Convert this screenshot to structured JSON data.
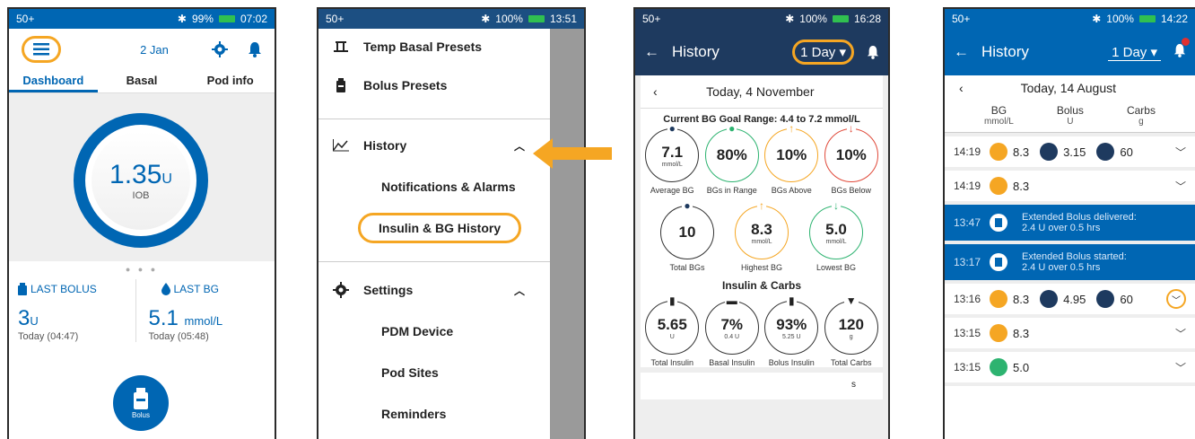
{
  "colors": {
    "accent": "#0066b3",
    "navy": "#1e3a5f",
    "highlight": "#f5a623",
    "bg_in_range": "#2db370",
    "bg_below": "#e04a3a"
  },
  "p1": {
    "status": {
      "signal": "50+",
      "battery": "99%",
      "time": "07:02"
    },
    "date": "2 Jan",
    "tabs": [
      "Dashboard",
      "Basal",
      "Pod info"
    ],
    "iob": {
      "value": "1.35",
      "unit": "U",
      "label": "IOB"
    },
    "last_bolus": {
      "label": "LAST BOLUS",
      "value": "3",
      "unit": "U",
      "time": "Today (04:47)"
    },
    "last_bg": {
      "label": "LAST BG",
      "value": "5.1",
      "unit": "mmol/L",
      "time": "Today (05:48)"
    },
    "bolus_button": "Bolus"
  },
  "p2": {
    "status": {
      "signal": "50+",
      "battery": "100%",
      "time": "13:51"
    },
    "menu": {
      "temp_basal": "Temp Basal Presets",
      "bolus_presets": "Bolus Presets",
      "history": "History",
      "notifications": "Notifications & Alarms",
      "insulin_bg": "Insulin & BG History",
      "settings": "Settings",
      "pdm": "PDM Device",
      "pod_sites": "Pod Sites",
      "reminders": "Reminders"
    }
  },
  "p3": {
    "status": {
      "signal": "50+",
      "battery": "100%",
      "time": "16:28"
    },
    "title": "History",
    "range": "1 Day",
    "date": "Today, 4 November",
    "goal": "Current BG Goal Range: 4.4 to 7.2 mmol/L",
    "bg_stats": [
      {
        "value": "7.1",
        "unit": "mmol/L",
        "label": "Average BG",
        "icon": "drop-icon"
      },
      {
        "value": "80%",
        "unit": "",
        "label": "BGs in Range",
        "icon": "drop-icon"
      },
      {
        "value": "10%",
        "unit": "",
        "label": "BGs Above",
        "icon": "arrow-up-icon"
      },
      {
        "value": "10%",
        "unit": "",
        "label": "BGs Below",
        "icon": "arrow-down-icon"
      }
    ],
    "bg_stats2": [
      {
        "value": "10",
        "unit": "",
        "label": "Total BGs",
        "icon": "drop-icon"
      },
      {
        "value": "8.3",
        "unit": "mmol/L",
        "label": "Highest BG",
        "icon": "arrow-up-icon"
      },
      {
        "value": "5.0",
        "unit": "mmol/L",
        "label": "Lowest BG",
        "icon": "arrow-down-icon"
      }
    ],
    "section_insulin": "Insulin & Carbs",
    "insulin_stats": [
      {
        "value": "5.65",
        "unit": "U",
        "label": "Total Insulin"
      },
      {
        "value": "7%",
        "unit": "0.4 U",
        "label": "Basal Insulin"
      },
      {
        "value": "93%",
        "unit": "5.25 U",
        "label": "Bolus Insulin"
      },
      {
        "value": "120",
        "unit": "g",
        "label": "Total Carbs"
      }
    ],
    "bottom_s": "s"
  },
  "p4": {
    "status": {
      "signal": "50+",
      "battery": "100%",
      "time": "14:22"
    },
    "title": "History",
    "range": "1 Day",
    "date": "Today, 14 August",
    "cols": [
      {
        "name": "BG",
        "unit": "mmol/L"
      },
      {
        "name": "Bolus",
        "unit": "U"
      },
      {
        "name": "Carbs",
        "unit": "g"
      }
    ],
    "rows": [
      {
        "time": "14:19",
        "bg": "8.3",
        "bolus": "3.15",
        "carbs": "60"
      },
      {
        "time": "14:19",
        "bg": "8.3"
      },
      {
        "time": "13:47",
        "text": "Extended Bolus delivered:",
        "sub": "2.4 U over 0.5 hrs"
      },
      {
        "time": "13:17",
        "text": "Extended Bolus started:",
        "sub": "2.4 U over 0.5 hrs"
      },
      {
        "time": "13:16",
        "bg": "8.3",
        "bolus": "4.95",
        "carbs": "60"
      },
      {
        "time": "13:15",
        "bg": "8.3"
      },
      {
        "time": "13:15",
        "bg": "5.0"
      }
    ]
  }
}
